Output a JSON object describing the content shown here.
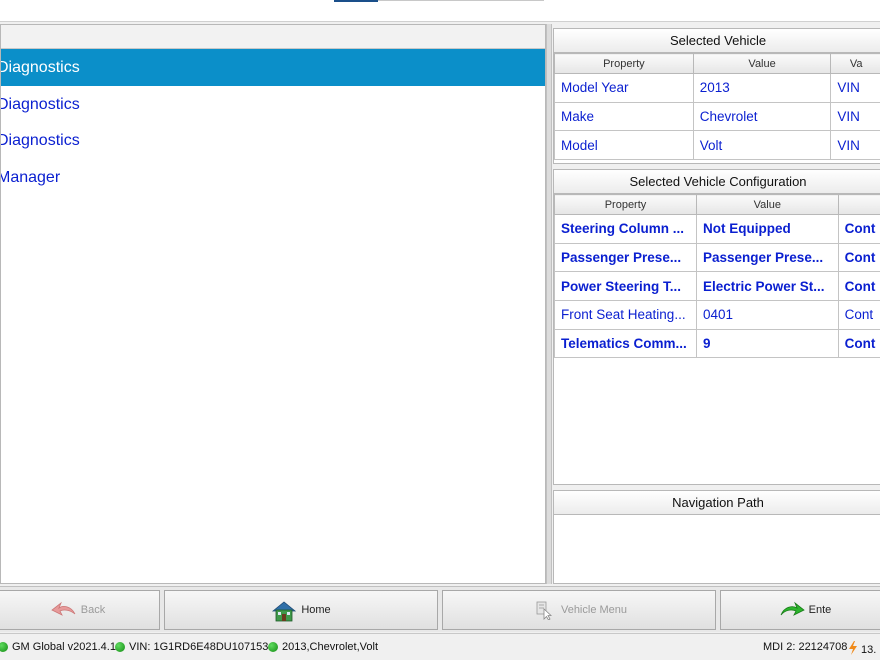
{
  "left_menu": {
    "items": [
      {
        "label": "Diagnostics",
        "selected": true
      },
      {
        "label": "Diagnostics",
        "selected": false
      },
      {
        "label": "Diagnostics",
        "selected": false
      },
      {
        "label": "Manager",
        "selected": false
      }
    ]
  },
  "selected_vehicle": {
    "title": "Selected Vehicle",
    "columns": [
      "Property",
      "Value",
      "Va"
    ],
    "rows": [
      {
        "property": "Model Year",
        "value": "2013",
        "extra": "VIN"
      },
      {
        "property": "Make",
        "value": "Chevrolet",
        "extra": "VIN"
      },
      {
        "property": "Model",
        "value": "Volt",
        "extra": "VIN"
      }
    ]
  },
  "vehicle_configuration": {
    "title": "Selected Vehicle Configuration",
    "columns": [
      "Property",
      "Value",
      ""
    ],
    "rows": [
      {
        "property": "Steering Column ...",
        "value": "Not Equipped",
        "extra": "Cont",
        "bold": true
      },
      {
        "property": "Passenger Prese...",
        "value": "Passenger Prese...",
        "extra": "Cont",
        "bold": true
      },
      {
        "property": "Power Steering T...",
        "value": "Electric Power St...",
        "extra": "Cont",
        "bold": true
      },
      {
        "property": "Front Seat Heating...",
        "value": "0401",
        "extra": "Cont",
        "bold": false
      },
      {
        "property": "Telematics Comm...",
        "value": "9",
        "extra": "Cont",
        "bold": true
      }
    ]
  },
  "navigation_path": {
    "title": "Navigation Path"
  },
  "toolbar": {
    "back_label": "Back",
    "home_label": "Home",
    "vehicle_menu_label": "Vehicle Menu",
    "enter_label": "Ente"
  },
  "status_bar": {
    "software": "GM Global v2021.4.1",
    "vin": "VIN: 1G1RD6E48DU107153",
    "vehicle": "2013,Chevrolet,Volt",
    "mdi": "MDI 2: 22124708",
    "voltage": "13."
  },
  "colors": {
    "selection": "#0b8fc9",
    "link_text": "#0a1fd0",
    "status_ok": "#1aa31a"
  }
}
